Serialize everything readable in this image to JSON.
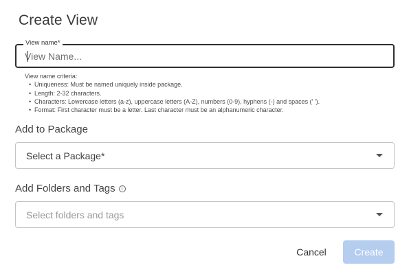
{
  "dialog": {
    "title": "Create View"
  },
  "view_name": {
    "legend": "View name*",
    "placeholder": "View Name...",
    "value": "",
    "criteria_title": "View name criteria:",
    "criteria": [
      "Uniqueness: Must be named uniquely inside package.",
      "Length: 2-32 characters.",
      "Characters: Lowercase letters (a-z), uppercase letters (A-Z), numbers (0-9), hyphens (-) and spaces (' ').",
      "Format: First character must be a letter. Last character must be an alphanumeric character."
    ]
  },
  "package": {
    "label": "Add to Package",
    "selected": "Select a Package*"
  },
  "folders_tags": {
    "label": "Add Folders and Tags",
    "info_icon": "info-icon",
    "placeholder": "Select folders and tags"
  },
  "actions": {
    "cancel_label": "Cancel",
    "create_label": "Create"
  },
  "colors": {
    "create_disabled": "#b5cdef",
    "field_border_focused": "#2f2f2f"
  }
}
